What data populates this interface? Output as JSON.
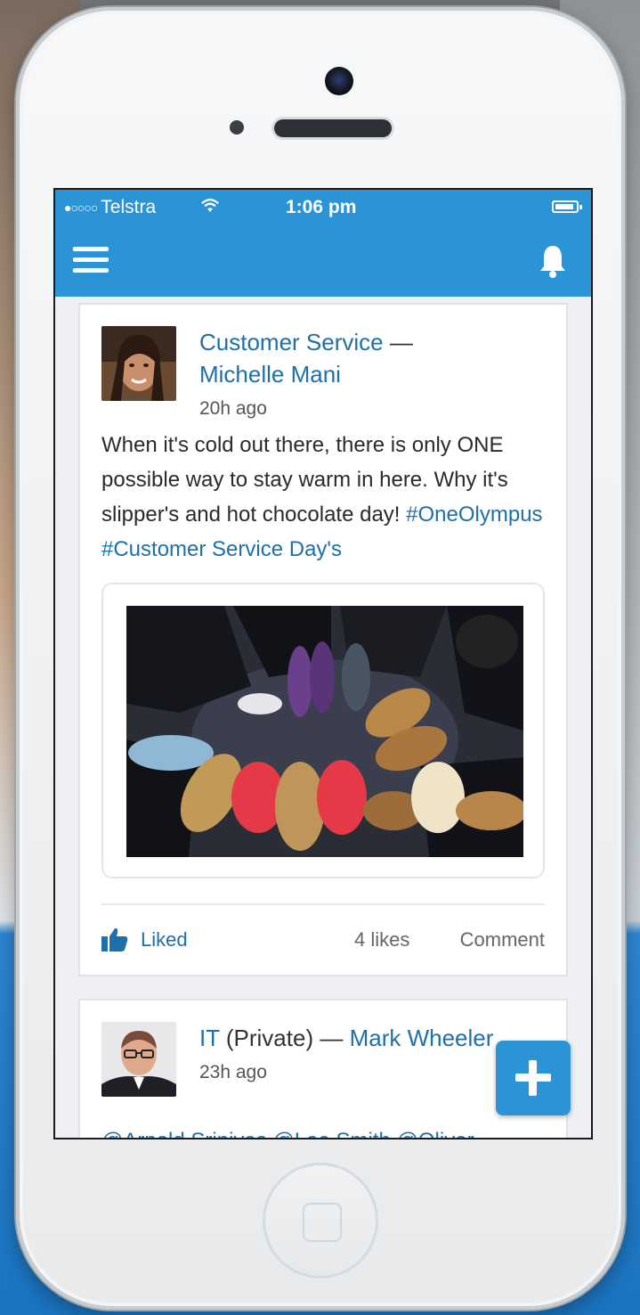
{
  "status_bar": {
    "signal_dots": "●○○○○",
    "carrier": "Telstra",
    "time": "1:06 pm"
  },
  "nav": {
    "menu_icon": "hamburger-icon",
    "notifications_icon": "bell-icon"
  },
  "posts": [
    {
      "group": "Customer Service",
      "separator": "—",
      "author": "Michelle Mani",
      "time_ago": "20h ago",
      "text": "When it's cold out there, there is only ONE possible way to stay warm in here. Why it's slipper's and hot chocolate day!",
      "hashtags": "#OneOlympus #Customer Service Day's",
      "liked_label": "Liked",
      "likes_count": "4 likes",
      "comment_label": "Comment"
    },
    {
      "group": "IT",
      "group_suffix": " (Private)",
      "separator": "—",
      "author": "Mark Wheeler",
      "time_ago": "23h ago",
      "mentions": "@Arnold Srinivas @Lee Smith @Oliver"
    }
  ],
  "fab": {
    "icon": "plus-icon"
  },
  "colors": {
    "brand_blue": "#2a94d6",
    "link_blue": "#1f6fa8"
  }
}
